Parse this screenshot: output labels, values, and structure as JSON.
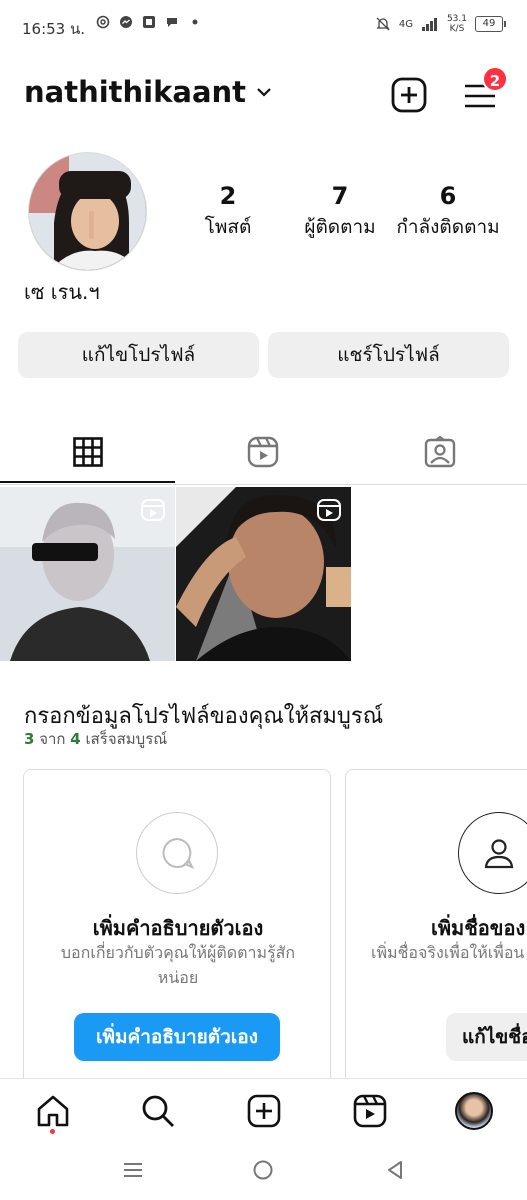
{
  "status": {
    "time": "16:53 น.",
    "network": "4G",
    "speed_value": "53.1",
    "speed_unit": "K/S",
    "battery": "49"
  },
  "header": {
    "username": "nathithikaant",
    "notifications": "2"
  },
  "profile": {
    "display_name": "เซ เรน.ฯ",
    "stats": [
      {
        "value": "2",
        "label": "โพสต์"
      },
      {
        "value": "7",
        "label": "ผู้ติดตาม"
      },
      {
        "value": "6",
        "label": "กำลังติดตาม"
      }
    ],
    "edit_button": "แก้ไขโปรไฟล์",
    "share_button": "แชร์โปรไฟล์"
  },
  "complete_profile": {
    "title": "กรอกข้อมูลโปรไฟล์ของคุณให้สมบูรณ์",
    "done": "3",
    "from": "จาก",
    "total": "4",
    "suffix": "เสร็จสมบูรณ์",
    "cards": [
      {
        "title": "เพิ่มคำอธิบายตัวเอง",
        "desc": "บอกเกี่ยวกับตัวคุณให้ผู้ติดตามรู้สักหน่อย",
        "button": "เพิ่มคำอธิบายตัวเอง"
      },
      {
        "title": "เพิ่มชื่อของ",
        "desc": "เพิ่มชื่อจริงเพื่อให้เพื่อน",
        "button": "แก้ไขชื่อ"
      }
    ]
  },
  "icons": {
    "create": "plus-square-icon",
    "menu": "hamburger-icon",
    "grid_tab": "grid-icon",
    "reels_tab": "reels-icon",
    "tagged_tab": "tagged-icon",
    "home": "home-icon",
    "search": "search-icon",
    "new_post": "plus-square-icon",
    "reels": "reels-icon"
  },
  "colors": {
    "accent": "#1a9af5",
    "badge": "#ff3040",
    "success": "#2e7d32"
  }
}
